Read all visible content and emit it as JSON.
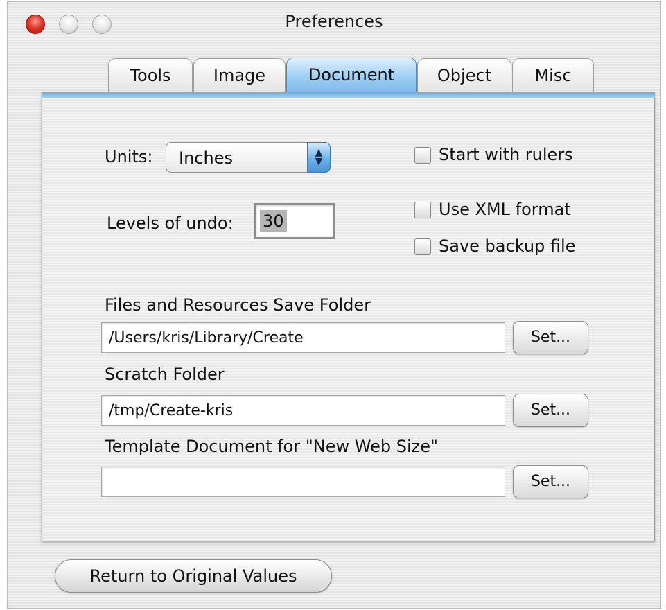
{
  "window": {
    "title": "Preferences"
  },
  "tabs": [
    {
      "label": "Tools",
      "selected": false
    },
    {
      "label": "Image",
      "selected": false
    },
    {
      "label": "Document",
      "selected": true
    },
    {
      "label": "Object",
      "selected": false
    },
    {
      "label": "Misc",
      "selected": false
    }
  ],
  "document": {
    "units": {
      "label": "Units:",
      "value": "Inches"
    },
    "undo": {
      "label": "Levels of undo:",
      "value": "30"
    },
    "checkboxes": [
      {
        "label": "Start with rulers",
        "checked": false
      },
      {
        "label": "Use XML format",
        "checked": false
      },
      {
        "label": "Save backup file",
        "checked": false
      }
    ],
    "folders": [
      {
        "label": "Files and Resources Save Folder",
        "value": "/Users/kris/Library/Create",
        "button": "Set..."
      },
      {
        "label": "Scratch Folder",
        "value": "/tmp/Create-kris",
        "button": "Set..."
      },
      {
        "label": "Template Document for \"New Web Size\"",
        "value": "",
        "button": "Set..."
      }
    ]
  },
  "footer": {
    "return_label": "Return to Original Values"
  },
  "colors": {
    "accent": "#7db8ea",
    "close_button": "#e0382a"
  },
  "icons": {
    "popup_arrows": "up-down-arrows-icon"
  }
}
